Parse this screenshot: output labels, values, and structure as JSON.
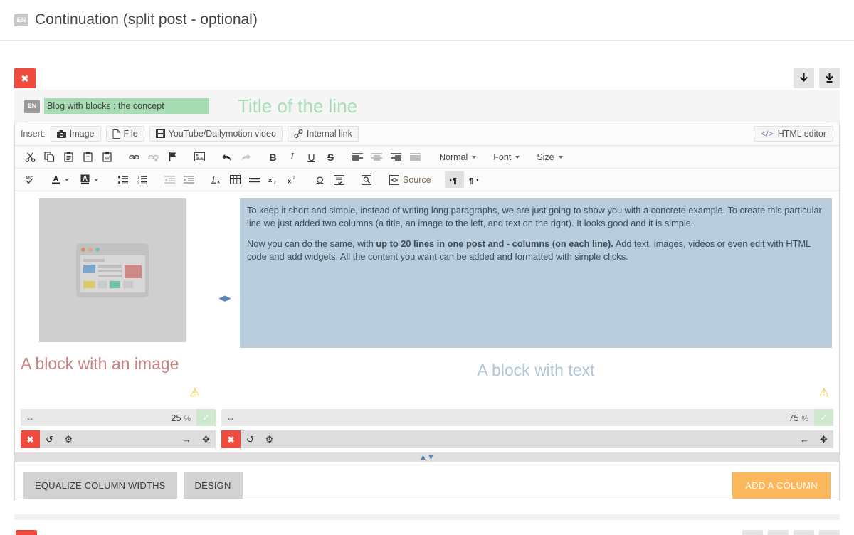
{
  "header": {
    "lang_badge": "EN",
    "title": "Continuation (split post - optional)"
  },
  "line": {
    "delete_label": "✖",
    "move_down_title": "Move down",
    "move_bottom_title": "Move to bottom",
    "lang_badge": "EN",
    "title_value": "Blog with blocks : the concept",
    "title_placeholder": "Title of the line",
    "title_ghost": "Title of the line"
  },
  "insert_bar": {
    "label": "Insert:",
    "buttons": [
      {
        "icon": "camera-icon",
        "label": "Image"
      },
      {
        "icon": "file-icon",
        "label": "File"
      },
      {
        "icon": "film-icon",
        "label": "YouTube/Dailymotion video"
      },
      {
        "icon": "link-icon",
        "label": "Internal link"
      }
    ],
    "html_editor": {
      "icon": "code-icon",
      "label": "HTML editor"
    }
  },
  "toolbar_row1": {
    "group_clipboard": [
      {
        "name": "cut-icon",
        "glyph": "✂",
        "title": "Cut"
      },
      {
        "name": "copy-icon",
        "glyph": "⧉",
        "title": "Copy"
      },
      {
        "name": "paste-icon",
        "glyph": "📋",
        "title": "Paste"
      },
      {
        "name": "paste-text-icon",
        "glyph": "📋",
        "title": "Paste as plain text"
      },
      {
        "name": "paste-word-icon",
        "glyph": "📋",
        "title": "Paste from Word"
      }
    ],
    "group_link": [
      {
        "name": "link-icon",
        "glyph": "🔗",
        "title": "Link"
      },
      {
        "name": "unlink-icon",
        "glyph": "🔗",
        "title": "Unlink",
        "disabled": true
      },
      {
        "name": "anchor-flag-icon",
        "glyph": "⚑",
        "title": "Anchor"
      }
    ],
    "group_image": [
      {
        "name": "image-icon",
        "glyph": "🏞",
        "title": "Image"
      }
    ],
    "group_history": [
      {
        "name": "undo-icon",
        "glyph": "↩",
        "title": "Undo"
      },
      {
        "name": "redo-icon",
        "glyph": "↪",
        "title": "Redo",
        "disabled": true
      }
    ],
    "group_format": [
      {
        "name": "bold-icon",
        "glyph": "B",
        "title": "Bold"
      },
      {
        "name": "italic-icon",
        "glyph": "I",
        "title": "Italic"
      },
      {
        "name": "underline-icon",
        "glyph": "U",
        "title": "Underline"
      },
      {
        "name": "strike-icon",
        "glyph": "S",
        "title": "Strikethrough"
      }
    ],
    "group_align": [
      {
        "name": "align-left-icon",
        "title": "Align left"
      },
      {
        "name": "align-center-icon",
        "title": "Center"
      },
      {
        "name": "align-right-icon",
        "title": "Align right"
      },
      {
        "name": "justify-icon",
        "title": "Justify"
      }
    ],
    "combos": [
      {
        "name": "paragraph-format-select",
        "label": "Normal"
      },
      {
        "name": "font-family-select",
        "label": "Font"
      },
      {
        "name": "font-size-select",
        "label": "Size"
      }
    ]
  },
  "toolbar_row2": {
    "group_spell": [
      {
        "name": "spellcheck-icon",
        "glyph": "ABC",
        "title": "Spell check as you type"
      }
    ],
    "group_color": [
      {
        "name": "text-color-icon",
        "glyph": "A",
        "title": "Text color"
      },
      {
        "name": "background-color-icon",
        "glyph": "A",
        "title": "Background color"
      }
    ],
    "group_list": [
      {
        "name": "bulleted-list-icon",
        "title": "Insert/remove bulleted list"
      },
      {
        "name": "numbered-list-icon",
        "title": "Insert/remove numbered list"
      }
    ],
    "group_indent": [
      {
        "name": "outdent-icon",
        "title": "Decrease indent",
        "disabled": true
      },
      {
        "name": "indent-icon",
        "title": "Increase indent"
      }
    ],
    "group_tools": [
      {
        "name": "remove-format-icon",
        "glyph": "I",
        "title": "Remove format"
      },
      {
        "name": "table-icon",
        "title": "Table"
      },
      {
        "name": "horizontal-rule-icon",
        "title": "Horizontal line"
      },
      {
        "name": "subscript-icon",
        "glyph": "x",
        "title": "Subscript"
      },
      {
        "name": "superscript-icon",
        "glyph": "x",
        "title": "Superscript"
      }
    ],
    "group_special": [
      {
        "name": "special-char-icon",
        "glyph": "Ω",
        "title": "Insert special character"
      },
      {
        "name": "page-break-icon",
        "title": "Page break"
      }
    ],
    "group_preview": [
      {
        "name": "preview-icon",
        "title": "Preview"
      }
    ],
    "source": {
      "name": "source-button",
      "label": "Source"
    },
    "group_direction": [
      {
        "name": "text-direction-ltr-icon",
        "glyph": "¶",
        "title": "Text direction from left to right",
        "active": true
      },
      {
        "name": "text-direction-rtl-icon",
        "glyph": "¶",
        "title": "Text direction from right to left"
      }
    ]
  },
  "columns": [
    {
      "type": "image",
      "block_title": "A block with an image",
      "width_value": "25",
      "width_unit": "%",
      "confirm_label": "✓",
      "warning_icon": "warning-triangle-icon",
      "controls": {
        "delete": "✖",
        "reset": "↺",
        "settings": "⚙",
        "arrow": "→",
        "move": "✥"
      }
    },
    {
      "type": "text",
      "block_title": "A block with text",
      "width_value": "75",
      "width_unit": "%",
      "confirm_label": "✓",
      "warning_icon": "warning-triangle-icon",
      "paragraphs": [
        {
          "runs": [
            {
              "text": "To keep it short and simple, instead of writing long paragraphs, we are just going to show you with a concrete example. To create this particular line we just added two columns (a title, an image to the left, and text on the right). It looks good and it is simple.",
              "bold": false
            }
          ]
        },
        {
          "runs": [
            {
              "text": "Now you can do the same, with ",
              "bold": false
            },
            {
              "text": "up to 20 lines in one post and - columns (on each line).",
              "bold": true
            },
            {
              "text": " Add text, images, videos or even edit with HTML code and add widgets. All the content you want can be added and formatted with simple clicks.",
              "bold": false
            }
          ]
        }
      ],
      "controls": {
        "delete": "✖",
        "reset": "↺",
        "settings": "⚙",
        "arrow": "←",
        "move": "✥"
      }
    }
  ],
  "footer_buttons": {
    "equalize": "EQUALIZE COLUMN WIDTHS",
    "design": "DESIGN",
    "add_column": "ADD A COLUMN"
  },
  "colors": {
    "danger": "#ef4b3f",
    "accent_orange": "#fbb75c",
    "title_green": "#a8dcb5",
    "text_block_bg": "#b8cede",
    "image_title": "#c98383",
    "text_title": "#b0c6d6",
    "warning": "#f7c024"
  }
}
